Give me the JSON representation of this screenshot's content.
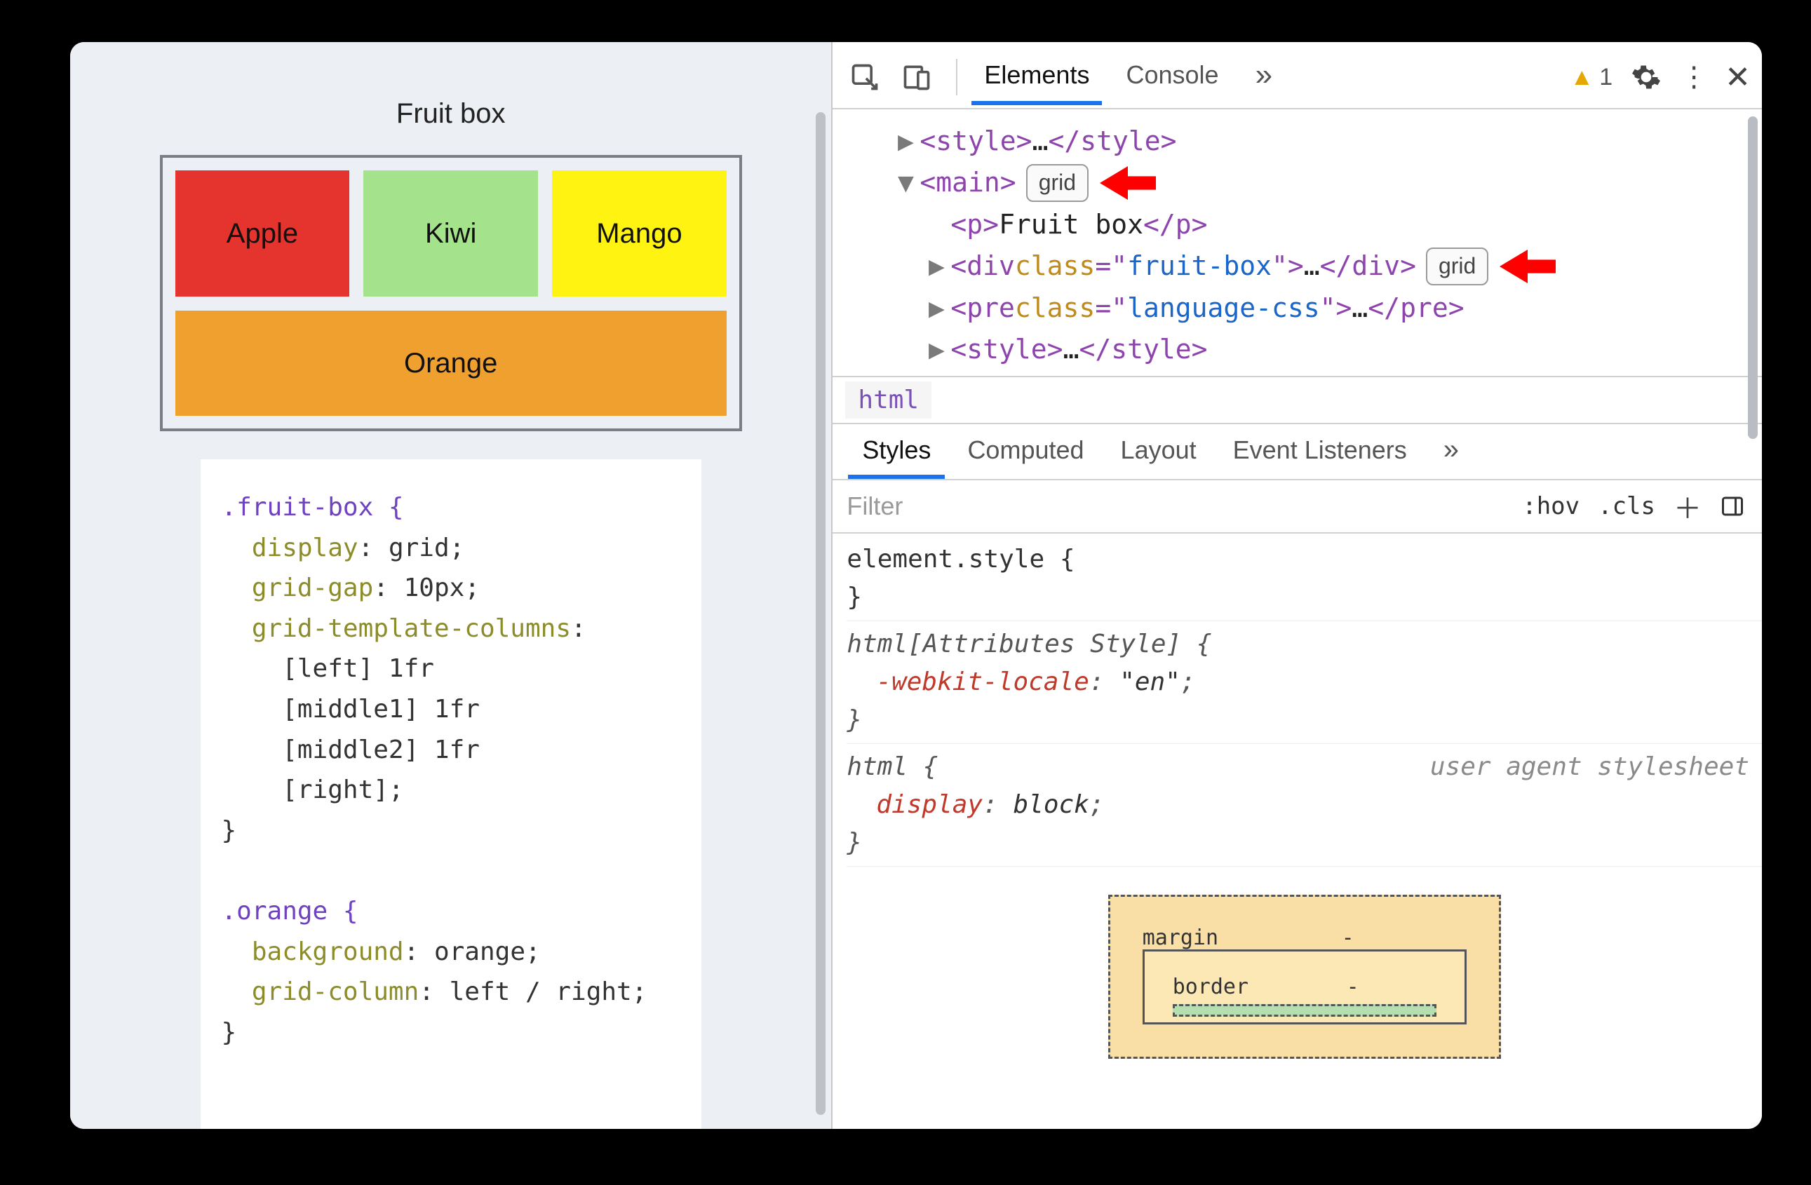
{
  "page": {
    "title": "Fruit box",
    "fruits": {
      "apple": "Apple",
      "kiwi": "Kiwi",
      "mango": "Mango",
      "orange": "Orange"
    },
    "css_lines": [
      {
        "t": "sel",
        "v": ".fruit-box {"
      },
      {
        "t": "propval",
        "prop": "  display",
        "val": "grid"
      },
      {
        "t": "propval",
        "prop": "  grid-gap",
        "val": "10px"
      },
      {
        "t": "prop",
        "prop": "  grid-template-columns",
        "suffix": ":"
      },
      {
        "t": "val",
        "v": "    [left] 1fr"
      },
      {
        "t": "val",
        "v": "    [middle1] 1fr"
      },
      {
        "t": "val",
        "v": "    [middle2] 1fr"
      },
      {
        "t": "val",
        "v": "    [right];"
      },
      {
        "t": "plain",
        "v": "}"
      },
      {
        "t": "blank",
        "v": ""
      },
      {
        "t": "sel",
        "v": ".orange {"
      },
      {
        "t": "propval",
        "prop": "  background",
        "val": "orange"
      },
      {
        "t": "propval",
        "prop": "  grid-column",
        "val": "left / right"
      },
      {
        "t": "plain",
        "v": "}"
      }
    ]
  },
  "devtools": {
    "tabs": {
      "elements": "Elements",
      "console": "Console"
    },
    "warning_count": "1",
    "elements_tree": {
      "style1": {
        "open": "<style>",
        "ell": "…",
        "close": "</style>"
      },
      "main": {
        "open": "<main>",
        "badge": "grid"
      },
      "p": {
        "open": "<p>",
        "text": "Fruit box",
        "close": "</p>"
      },
      "div": {
        "open": "<div class=\"fruit-box\">",
        "ell": "…",
        "close": "</div>",
        "badge": "grid"
      },
      "pre": {
        "open": "<pre class=\"language-css\">",
        "ell": "…",
        "close": "</pre>"
      },
      "style2": {
        "open": "<style>",
        "ell": "…",
        "close": "</style>"
      }
    },
    "breadcrumb": "html",
    "subtabs": {
      "styles": "Styles",
      "computed": "Computed",
      "layout": "Layout",
      "eventlisteners": "Event Listeners"
    },
    "filter_placeholder": "Filter",
    "filter_tools": {
      "hov": ":hov",
      "cls": ".cls"
    },
    "styles_panel": {
      "element_style": {
        "sel": "element.style {",
        "close": "}"
      },
      "attr_style": {
        "sel": "html[Attributes Style] {",
        "prop": "-webkit-locale",
        "val": "\"en\"",
        "close": "}"
      },
      "html_rule": {
        "sel": "html {",
        "agent": "user agent stylesheet",
        "prop": "display",
        "val": "block",
        "close": "}"
      }
    },
    "boxmodel": {
      "margin": "margin",
      "border": "border",
      "dash": "-"
    }
  }
}
